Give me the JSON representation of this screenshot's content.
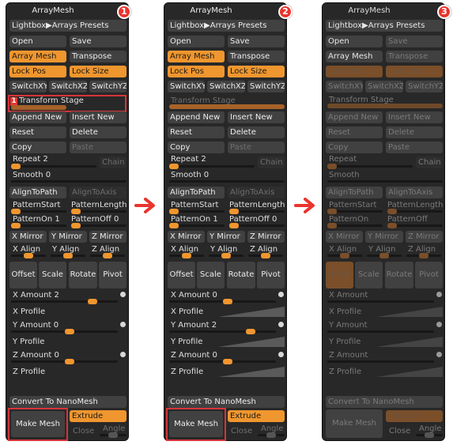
{
  "panel_title": "ArrayMesh",
  "lightbox_label": "Lightbox▶Arrays Presets",
  "open": "Open",
  "save": "Save",
  "array_mesh": "Array Mesh",
  "transpose": "Transpose",
  "lock_pos": "Lock Pos",
  "lock_size": "Lock Size",
  "switch_xy": "SwitchXY",
  "switch_xz": "SwitchXZ",
  "switch_yz": "SwitchYZ",
  "transform_stage": "Transform Stage",
  "stage_number": "1",
  "append_new": "Append New",
  "insert_new": "Insert New",
  "reset": "Reset",
  "delete": "Delete",
  "copy": "Copy",
  "paste": "Paste",
  "repeat": "Repeat",
  "chain": "Chain",
  "smooth": "Smooth",
  "align_to_path": "AlignToPath",
  "align_to_axis": "AlignToAxis",
  "pattern_start": "PatternStart",
  "pattern_length": "PatternLength",
  "pattern_on": "PatternOn",
  "pattern_off": "PatternOff",
  "x_mirror": "X Mirror",
  "y_mirror": "Y Mirror",
  "z_mirror": "Z Mirror",
  "x_align": "X Align",
  "y_align": "Y Align",
  "z_align": "Z Align",
  "offset": "Offset",
  "scale": "Scale",
  "rotate": "Rotate",
  "pivot": "Pivot",
  "x_amount": "X Amount",
  "x_profile": "X Profile",
  "y_amount": "Y Amount",
  "y_profile": "Y Profile",
  "z_amount": "Z Amount",
  "z_profile": "Z Profile",
  "convert_nano": "Convert To NanoMesh",
  "make_mesh": "Make Mesh",
  "extrude": "Extrude",
  "close": "Close",
  "angle": "Angle",
  "panels": [
    {
      "badge": "1",
      "repeat_val": "2",
      "smooth_val": "0",
      "pattern_on_val": "1",
      "pattern_off_val": "0",
      "x_amount_val": "2",
      "y_amount_val": "0",
      "z_amount_val": "0",
      "stage_label_shown": "Transform Stage"
    },
    {
      "badge": "2",
      "repeat_val": "2",
      "smooth_val": "0",
      "pattern_on_val": "1",
      "pattern_off_val": "0",
      "x_amount_val": "0",
      "y_amount_val": "2",
      "z_amount_val": "0",
      "stage_label_shown": "Transform Stage"
    },
    {
      "badge": "3",
      "stage_label_shown": "Transform Stage"
    }
  ],
  "colors": {
    "accent": "#f0962e",
    "panel": "#282828",
    "button": "#414141",
    "highlight": "#d6343a",
    "arrow": "#e8352e"
  }
}
